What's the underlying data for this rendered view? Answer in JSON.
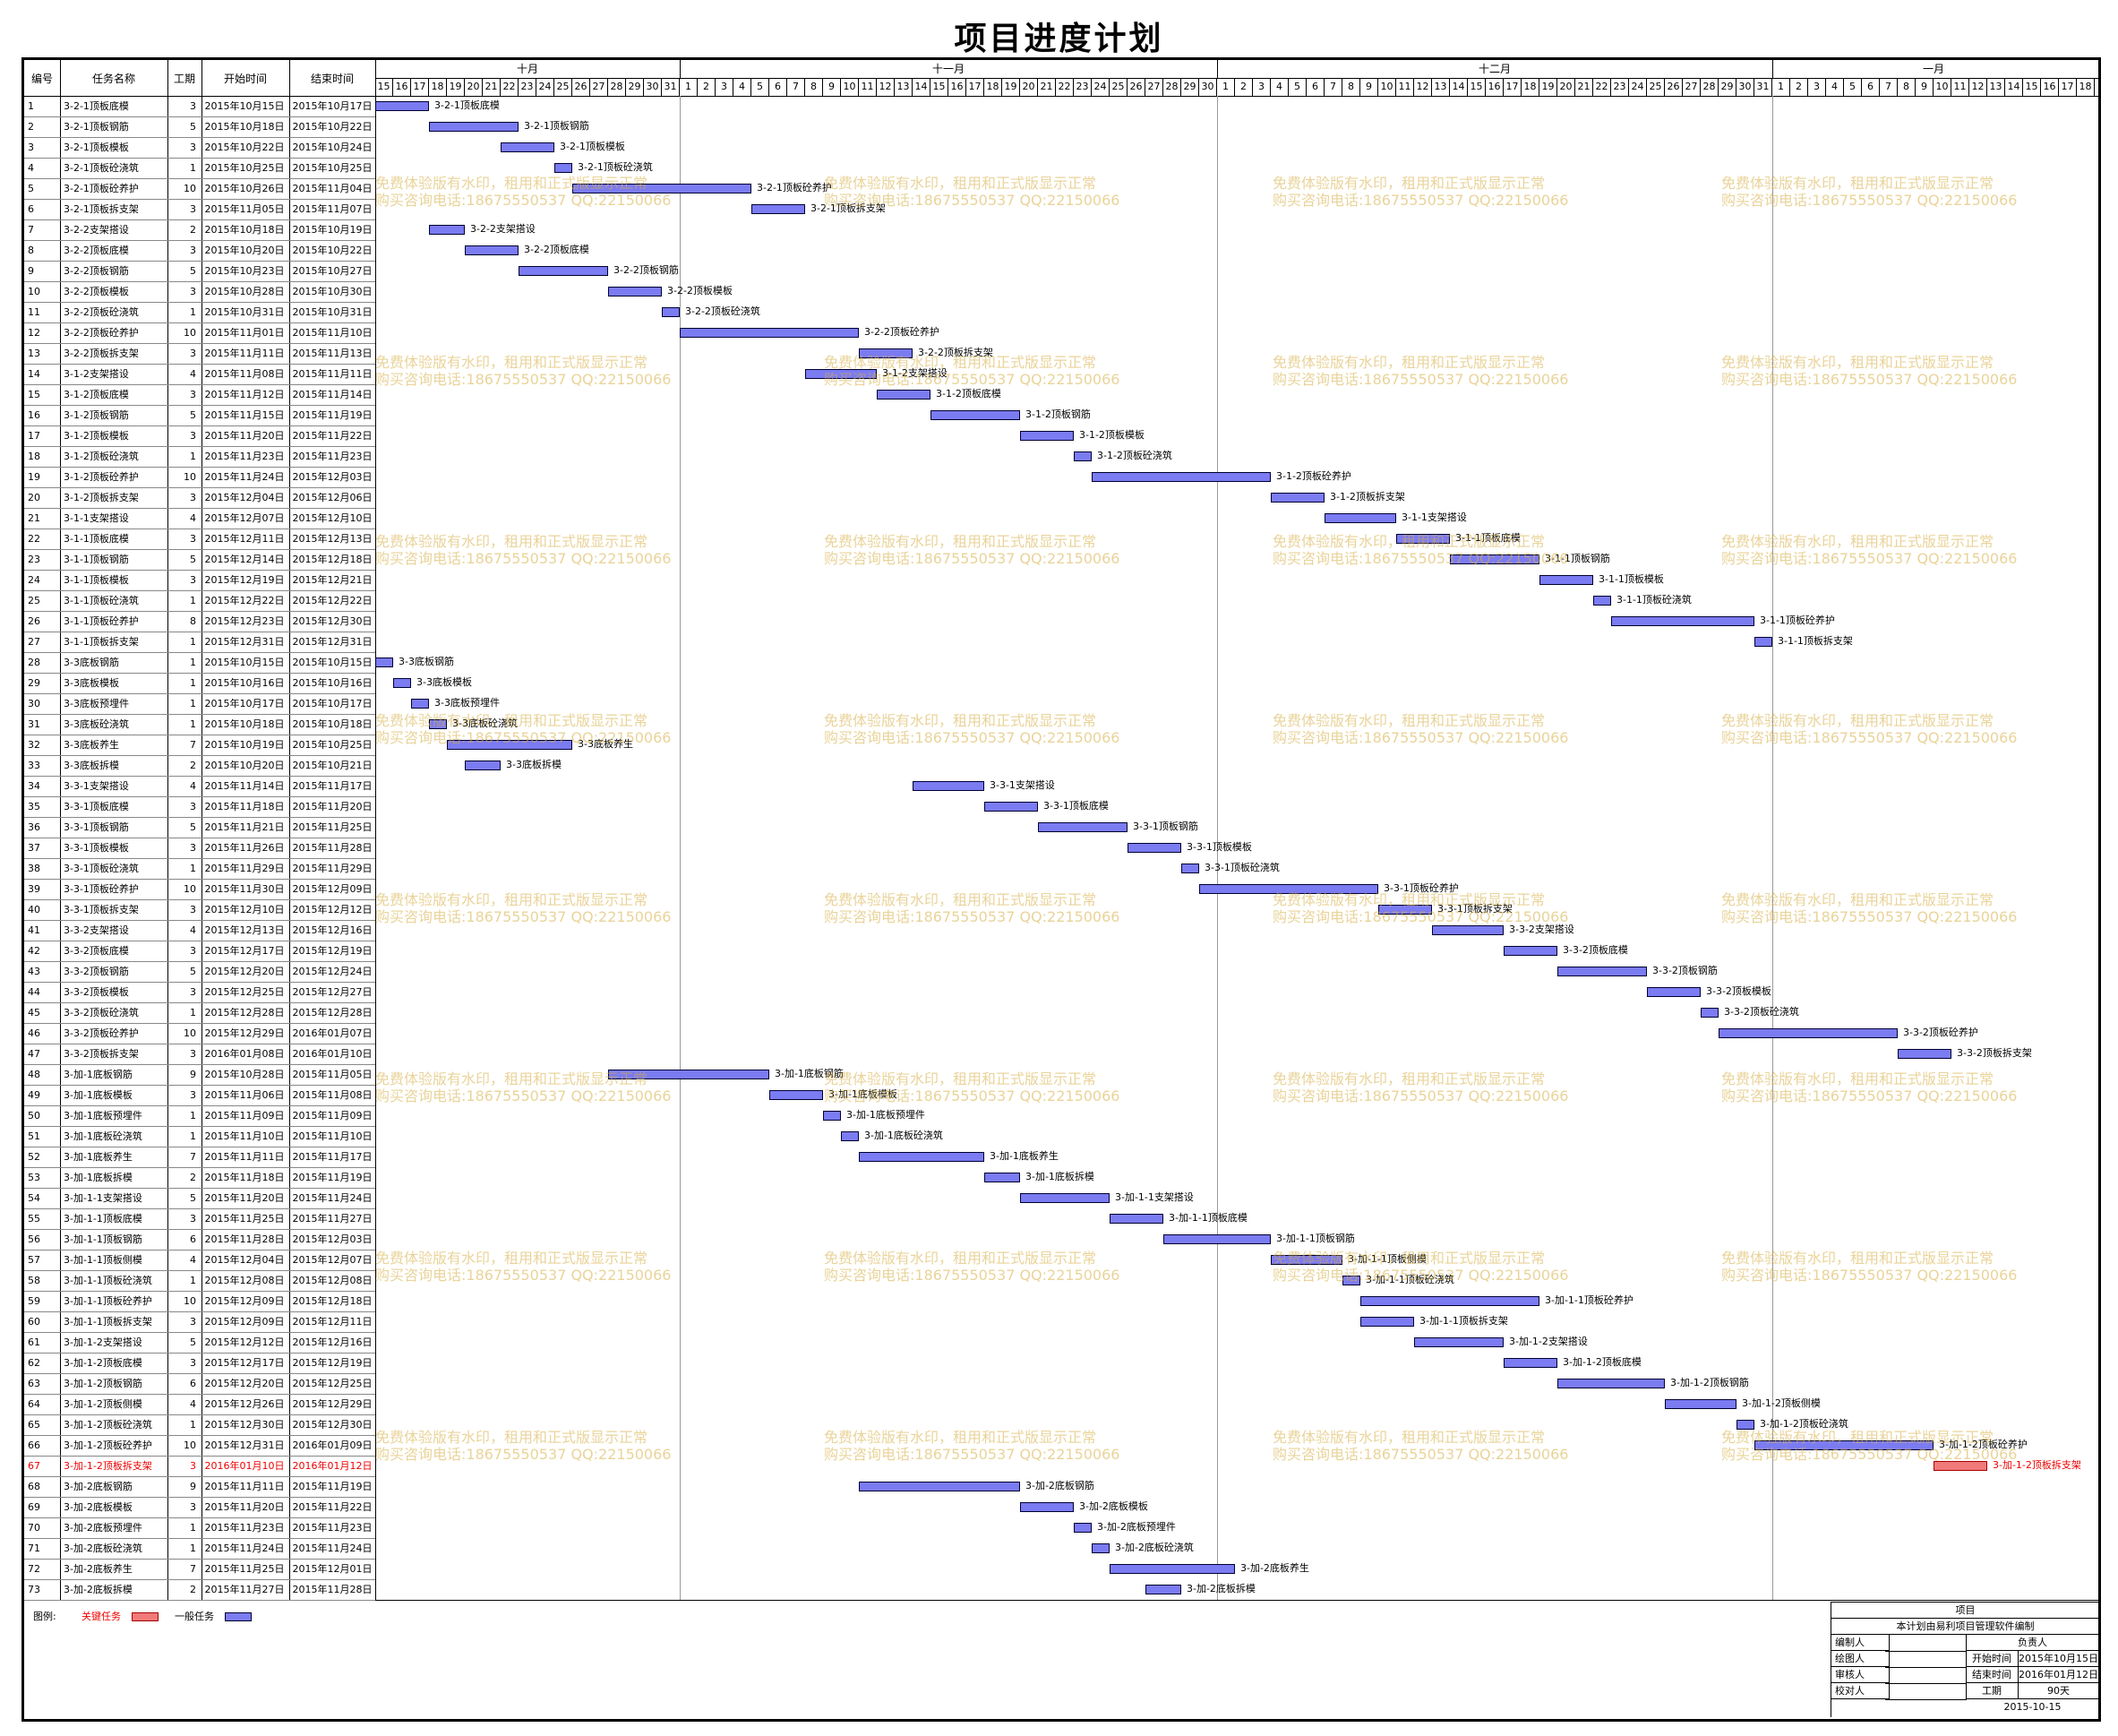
{
  "title": "项目进度计划",
  "columns": {
    "id": "编号",
    "name": "任务名称",
    "dur": "工期",
    "start": "开始时间",
    "end": "结束时间"
  },
  "months": [
    "十月",
    "十一月",
    "十二月",
    "一月"
  ],
  "day_labels": [
    "15",
    "16",
    "17",
    "18",
    "19",
    "20",
    "21",
    "22",
    "23",
    "24",
    "25",
    "26",
    "27",
    "28",
    "29",
    "30",
    "31",
    "1",
    "2",
    "3",
    "4",
    "5",
    "6",
    "7",
    "8",
    "9",
    "10",
    "11",
    "12",
    "13",
    "14",
    "15",
    "16",
    "17",
    "18",
    "19",
    "20",
    "21",
    "22",
    "23",
    "24",
    "25",
    "26",
    "27",
    "28",
    "29",
    "30",
    "1",
    "2",
    "3",
    "4",
    "5",
    "6",
    "7",
    "8",
    "9",
    "10",
    "11",
    "12",
    "13",
    "14",
    "15",
    "16",
    "17",
    "18",
    "19",
    "20",
    "21",
    "22",
    "23",
    "24",
    "25",
    "26",
    "27",
    "28",
    "29",
    "30",
    "31",
    "1",
    "2",
    "3",
    "4",
    "5",
    "6",
    "7",
    "8",
    "9",
    "10",
    "11",
    "12",
    "13",
    "14",
    "15",
    "16",
    "17",
    "18"
  ],
  "tasks": [
    {
      "id": "1",
      "name": "3-2-1顶板底模",
      "dur": "3",
      "start": "2015年10月15日",
      "end": "2015年10月17日",
      "s": 0,
      "d": 3,
      "crit": false
    },
    {
      "id": "2",
      "name": "3-2-1顶板钢筋",
      "dur": "5",
      "start": "2015年10月18日",
      "end": "2015年10月22日",
      "s": 3,
      "d": 5,
      "crit": false
    },
    {
      "id": "3",
      "name": "3-2-1顶板模板",
      "dur": "3",
      "start": "2015年10月22日",
      "end": "2015年10月24日",
      "s": 7,
      "d": 3,
      "crit": false
    },
    {
      "id": "4",
      "name": "3-2-1顶板砼浇筑",
      "dur": "1",
      "start": "2015年10月25日",
      "end": "2015年10月25日",
      "s": 10,
      "d": 1,
      "crit": false
    },
    {
      "id": "5",
      "name": "3-2-1顶板砼养护",
      "dur": "10",
      "start": "2015年10月26日",
      "end": "2015年11月04日",
      "s": 11,
      "d": 10,
      "crit": false
    },
    {
      "id": "6",
      "name": "3-2-1顶板拆支架",
      "dur": "3",
      "start": "2015年11月05日",
      "end": "2015年11月07日",
      "s": 21,
      "d": 3,
      "crit": false
    },
    {
      "id": "7",
      "name": "3-2-2支架搭设",
      "dur": "2",
      "start": "2015年10月18日",
      "end": "2015年10月19日",
      "s": 3,
      "d": 2,
      "crit": false
    },
    {
      "id": "8",
      "name": "3-2-2顶板底模",
      "dur": "3",
      "start": "2015年10月20日",
      "end": "2015年10月22日",
      "s": 5,
      "d": 3,
      "crit": false
    },
    {
      "id": "9",
      "name": "3-2-2顶板钢筋",
      "dur": "5",
      "start": "2015年10月23日",
      "end": "2015年10月27日",
      "s": 8,
      "d": 5,
      "crit": false
    },
    {
      "id": "10",
      "name": "3-2-2顶板模板",
      "dur": "3",
      "start": "2015年10月28日",
      "end": "2015年10月30日",
      "s": 13,
      "d": 3,
      "crit": false
    },
    {
      "id": "11",
      "name": "3-2-2顶板砼浇筑",
      "dur": "1",
      "start": "2015年10月31日",
      "end": "2015年10月31日",
      "s": 16,
      "d": 1,
      "crit": false
    },
    {
      "id": "12",
      "name": "3-2-2顶板砼养护",
      "dur": "10",
      "start": "2015年11月01日",
      "end": "2015年11月10日",
      "s": 17,
      "d": 10,
      "crit": false
    },
    {
      "id": "13",
      "name": "3-2-2顶板拆支架",
      "dur": "3",
      "start": "2015年11月11日",
      "end": "2015年11月13日",
      "s": 27,
      "d": 3,
      "crit": false
    },
    {
      "id": "14",
      "name": "3-1-2支架搭设",
      "dur": "4",
      "start": "2015年11月08日",
      "end": "2015年11月11日",
      "s": 24,
      "d": 4,
      "crit": false
    },
    {
      "id": "15",
      "name": "3-1-2顶板底模",
      "dur": "3",
      "start": "2015年11月12日",
      "end": "2015年11月14日",
      "s": 28,
      "d": 3,
      "crit": false
    },
    {
      "id": "16",
      "name": "3-1-2顶板钢筋",
      "dur": "5",
      "start": "2015年11月15日",
      "end": "2015年11月19日",
      "s": 31,
      "d": 5,
      "crit": false
    },
    {
      "id": "17",
      "name": "3-1-2顶板模板",
      "dur": "3",
      "start": "2015年11月20日",
      "end": "2015年11月22日",
      "s": 36,
      "d": 3,
      "crit": false
    },
    {
      "id": "18",
      "name": "3-1-2顶板砼浇筑",
      "dur": "1",
      "start": "2015年11月23日",
      "end": "2015年11月23日",
      "s": 39,
      "d": 1,
      "crit": false
    },
    {
      "id": "19",
      "name": "3-1-2顶板砼养护",
      "dur": "10",
      "start": "2015年11月24日",
      "end": "2015年12月03日",
      "s": 40,
      "d": 10,
      "crit": false
    },
    {
      "id": "20",
      "name": "3-1-2顶板拆支架",
      "dur": "3",
      "start": "2015年12月04日",
      "end": "2015年12月06日",
      "s": 50,
      "d": 3,
      "crit": false
    },
    {
      "id": "21",
      "name": "3-1-1支架搭设",
      "dur": "4",
      "start": "2015年12月07日",
      "end": "2015年12月10日",
      "s": 53,
      "d": 4,
      "crit": false
    },
    {
      "id": "22",
      "name": "3-1-1顶板底模",
      "dur": "3",
      "start": "2015年12月11日",
      "end": "2015年12月13日",
      "s": 57,
      "d": 3,
      "crit": false
    },
    {
      "id": "23",
      "name": "3-1-1顶板钢筋",
      "dur": "5",
      "start": "2015年12月14日",
      "end": "2015年12月18日",
      "s": 60,
      "d": 5,
      "crit": false
    },
    {
      "id": "24",
      "name": "3-1-1顶板模板",
      "dur": "3",
      "start": "2015年12月19日",
      "end": "2015年12月21日",
      "s": 65,
      "d": 3,
      "crit": false
    },
    {
      "id": "25",
      "name": "3-1-1顶板砼浇筑",
      "dur": "1",
      "start": "2015年12月22日",
      "end": "2015年12月22日",
      "s": 68,
      "d": 1,
      "crit": false
    },
    {
      "id": "26",
      "name": "3-1-1顶板砼养护",
      "dur": "8",
      "start": "2015年12月23日",
      "end": "2015年12月30日",
      "s": 69,
      "d": 8,
      "crit": false
    },
    {
      "id": "27",
      "name": "3-1-1顶板拆支架",
      "dur": "1",
      "start": "2015年12月31日",
      "end": "2015年12月31日",
      "s": 77,
      "d": 1,
      "crit": false
    },
    {
      "id": "28",
      "name": "3-3底板钢筋",
      "dur": "1",
      "start": "2015年10月15日",
      "end": "2015年10月15日",
      "s": 0,
      "d": 1,
      "crit": false
    },
    {
      "id": "29",
      "name": "3-3底板模板",
      "dur": "1",
      "start": "2015年10月16日",
      "end": "2015年10月16日",
      "s": 1,
      "d": 1,
      "crit": false
    },
    {
      "id": "30",
      "name": "3-3底板预埋件",
      "dur": "1",
      "start": "2015年10月17日",
      "end": "2015年10月17日",
      "s": 2,
      "d": 1,
      "crit": false
    },
    {
      "id": "31",
      "name": "3-3底板砼浇筑",
      "dur": "1",
      "start": "2015年10月18日",
      "end": "2015年10月18日",
      "s": 3,
      "d": 1,
      "crit": false
    },
    {
      "id": "32",
      "name": "3-3底板养生",
      "dur": "7",
      "start": "2015年10月19日",
      "end": "2015年10月25日",
      "s": 4,
      "d": 7,
      "crit": false
    },
    {
      "id": "33",
      "name": "3-3底板拆模",
      "dur": "2",
      "start": "2015年10月20日",
      "end": "2015年10月21日",
      "s": 5,
      "d": 2,
      "crit": false
    },
    {
      "id": "34",
      "name": "3-3-1支架搭设",
      "dur": "4",
      "start": "2015年11月14日",
      "end": "2015年11月17日",
      "s": 30,
      "d": 4,
      "crit": false
    },
    {
      "id": "35",
      "name": "3-3-1顶板底模",
      "dur": "3",
      "start": "2015年11月18日",
      "end": "2015年11月20日",
      "s": 34,
      "d": 3,
      "crit": false
    },
    {
      "id": "36",
      "name": "3-3-1顶板钢筋",
      "dur": "5",
      "start": "2015年11月21日",
      "end": "2015年11月25日",
      "s": 37,
      "d": 5,
      "crit": false
    },
    {
      "id": "37",
      "name": "3-3-1顶板模板",
      "dur": "3",
      "start": "2015年11月26日",
      "end": "2015年11月28日",
      "s": 42,
      "d": 3,
      "crit": false
    },
    {
      "id": "38",
      "name": "3-3-1顶板砼浇筑",
      "dur": "1",
      "start": "2015年11月29日",
      "end": "2015年11月29日",
      "s": 45,
      "d": 1,
      "crit": false
    },
    {
      "id": "39",
      "name": "3-3-1顶板砼养护",
      "dur": "10",
      "start": "2015年11月30日",
      "end": "2015年12月09日",
      "s": 46,
      "d": 10,
      "crit": false
    },
    {
      "id": "40",
      "name": "3-3-1顶板拆支架",
      "dur": "3",
      "start": "2015年12月10日",
      "end": "2015年12月12日",
      "s": 56,
      "d": 3,
      "crit": false
    },
    {
      "id": "41",
      "name": "3-3-2支架搭设",
      "dur": "4",
      "start": "2015年12月13日",
      "end": "2015年12月16日",
      "s": 59,
      "d": 4,
      "crit": false
    },
    {
      "id": "42",
      "name": "3-3-2顶板底模",
      "dur": "3",
      "start": "2015年12月17日",
      "end": "2015年12月19日",
      "s": 63,
      "d": 3,
      "crit": false
    },
    {
      "id": "43",
      "name": "3-3-2顶板钢筋",
      "dur": "5",
      "start": "2015年12月20日",
      "end": "2015年12月24日",
      "s": 66,
      "d": 5,
      "crit": false
    },
    {
      "id": "44",
      "name": "3-3-2顶板模板",
      "dur": "3",
      "start": "2015年12月25日",
      "end": "2015年12月27日",
      "s": 71,
      "d": 3,
      "crit": false
    },
    {
      "id": "45",
      "name": "3-3-2顶板砼浇筑",
      "dur": "1",
      "start": "2015年12月28日",
      "end": "2015年12月28日",
      "s": 74,
      "d": 1,
      "crit": false
    },
    {
      "id": "46",
      "name": "3-3-2顶板砼养护",
      "dur": "10",
      "start": "2015年12月29日",
      "end": "2016年01月07日",
      "s": 75,
      "d": 10,
      "crit": false
    },
    {
      "id": "47",
      "name": "3-3-2顶板拆支架",
      "dur": "3",
      "start": "2016年01月08日",
      "end": "2016年01月10日",
      "s": 85,
      "d": 3,
      "crit": false
    },
    {
      "id": "48",
      "name": "3-加-1底板钢筋",
      "dur": "9",
      "start": "2015年10月28日",
      "end": "2015年11月05日",
      "s": 13,
      "d": 9,
      "crit": false
    },
    {
      "id": "49",
      "name": "3-加-1底板模板",
      "dur": "3",
      "start": "2015年11月06日",
      "end": "2015年11月08日",
      "s": 22,
      "d": 3,
      "crit": false
    },
    {
      "id": "50",
      "name": "3-加-1底板预埋件",
      "dur": "1",
      "start": "2015年11月09日",
      "end": "2015年11月09日",
      "s": 25,
      "d": 1,
      "crit": false
    },
    {
      "id": "51",
      "name": "3-加-1底板砼浇筑",
      "dur": "1",
      "start": "2015年11月10日",
      "end": "2015年11月10日",
      "s": 26,
      "d": 1,
      "crit": false
    },
    {
      "id": "52",
      "name": "3-加-1底板养生",
      "dur": "7",
      "start": "2015年11月11日",
      "end": "2015年11月17日",
      "s": 27,
      "d": 7,
      "crit": false
    },
    {
      "id": "53",
      "name": "3-加-1底板拆模",
      "dur": "2",
      "start": "2015年11月18日",
      "end": "2015年11月19日",
      "s": 34,
      "d": 2,
      "crit": false
    },
    {
      "id": "54",
      "name": "3-加-1-1支架搭设",
      "dur": "5",
      "start": "2015年11月20日",
      "end": "2015年11月24日",
      "s": 36,
      "d": 5,
      "crit": false
    },
    {
      "id": "55",
      "name": "3-加-1-1顶板底模",
      "dur": "3",
      "start": "2015年11月25日",
      "end": "2015年11月27日",
      "s": 41,
      "d": 3,
      "crit": false
    },
    {
      "id": "56",
      "name": "3-加-1-1顶板钢筋",
      "dur": "6",
      "start": "2015年11月28日",
      "end": "2015年12月03日",
      "s": 44,
      "d": 6,
      "crit": false
    },
    {
      "id": "57",
      "name": "3-加-1-1顶板侧模",
      "dur": "4",
      "start": "2015年12月04日",
      "end": "2015年12月07日",
      "s": 50,
      "d": 4,
      "crit": false
    },
    {
      "id": "58",
      "name": "3-加-1-1顶板砼浇筑",
      "dur": "1",
      "start": "2015年12月08日",
      "end": "2015年12月08日",
      "s": 54,
      "d": 1,
      "crit": false
    },
    {
      "id": "59",
      "name": "3-加-1-1顶板砼养护",
      "dur": "10",
      "start": "2015年12月09日",
      "end": "2015年12月18日",
      "s": 55,
      "d": 10,
      "crit": false
    },
    {
      "id": "60",
      "name": "3-加-1-1顶板拆支架",
      "dur": "3",
      "start": "2015年12月09日",
      "end": "2015年12月11日",
      "s": 55,
      "d": 3,
      "crit": false
    },
    {
      "id": "61",
      "name": "3-加-1-2支架搭设",
      "dur": "5",
      "start": "2015年12月12日",
      "end": "2015年12月16日",
      "s": 58,
      "d": 5,
      "crit": false
    },
    {
      "id": "62",
      "name": "3-加-1-2顶板底模",
      "dur": "3",
      "start": "2015年12月17日",
      "end": "2015年12月19日",
      "s": 63,
      "d": 3,
      "crit": false
    },
    {
      "id": "63",
      "name": "3-加-1-2顶板钢筋",
      "dur": "6",
      "start": "2015年12月20日",
      "end": "2015年12月25日",
      "s": 66,
      "d": 6,
      "crit": false
    },
    {
      "id": "64",
      "name": "3-加-1-2顶板侧模",
      "dur": "4",
      "start": "2015年12月26日",
      "end": "2015年12月29日",
      "s": 72,
      "d": 4,
      "crit": false
    },
    {
      "id": "65",
      "name": "3-加-1-2顶板砼浇筑",
      "dur": "1",
      "start": "2015年12月30日",
      "end": "2015年12月30日",
      "s": 76,
      "d": 1,
      "crit": false
    },
    {
      "id": "66",
      "name": "3-加-1-2顶板砼养护",
      "dur": "10",
      "start": "2015年12月31日",
      "end": "2016年01月09日",
      "s": 77,
      "d": 10,
      "crit": false
    },
    {
      "id": "67",
      "name": "3-加-1-2顶板拆支架",
      "dur": "3",
      "start": "2016年01月10日",
      "end": "2016年01月12日",
      "s": 87,
      "d": 3,
      "crit": true
    },
    {
      "id": "68",
      "name": "3-加-2底板钢筋",
      "dur": "9",
      "start": "2015年11月11日",
      "end": "2015年11月19日",
      "s": 27,
      "d": 9,
      "crit": false
    },
    {
      "id": "69",
      "name": "3-加-2底板模板",
      "dur": "3",
      "start": "2015年11月20日",
      "end": "2015年11月22日",
      "s": 36,
      "d": 3,
      "crit": false
    },
    {
      "id": "70",
      "name": "3-加-2底板预埋件",
      "dur": "1",
      "start": "2015年11月23日",
      "end": "2015年11月23日",
      "s": 39,
      "d": 1,
      "crit": false
    },
    {
      "id": "71",
      "name": "3-加-2底板砼浇筑",
      "dur": "1",
      "start": "2015年11月24日",
      "end": "2015年11月24日",
      "s": 40,
      "d": 1,
      "crit": false
    },
    {
      "id": "72",
      "name": "3-加-2底板养生",
      "dur": "7",
      "start": "2015年11月25日",
      "end": "2015年12月01日",
      "s": 41,
      "d": 7,
      "crit": false
    },
    {
      "id": "73",
      "name": "3-加-2底板拆模",
      "dur": "2",
      "start": "2015年11月27日",
      "end": "2015年11月28日",
      "s": 43,
      "d": 2,
      "crit": false
    }
  ],
  "legend": {
    "label": "图例:",
    "critical": "关键任务",
    "normal": "一般任务"
  },
  "watermark": {
    "line1": "免费体验版有水印，租用和正式版显示正常",
    "line2": "购买咨询电话:18675550537 QQ:22150066"
  },
  "signature": {
    "project_label": "项目",
    "note": "本计划由易利项目管理软件编制",
    "editor": "编制人",
    "owner": "负责人",
    "drawer": "绘图人",
    "start_label": "开始时间",
    "start_value": "2015年10月15日",
    "reviewer": "审核人",
    "end_label": "结束时间",
    "end_value": "2016年01月12日",
    "checker": "校对人",
    "dur_label": "工期",
    "dur_value": "90天",
    "date": "2015-10-15"
  },
  "colors": {
    "bar": "#7b7bf2",
    "critical": "#f07a7a",
    "critical_text": "#e00000",
    "watermark": "#d7af46"
  }
}
